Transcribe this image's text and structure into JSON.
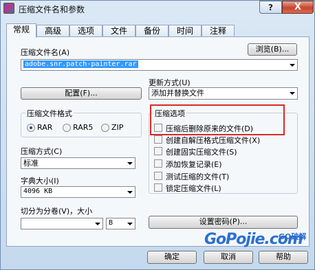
{
  "title": "压缩文件名和参数",
  "window": {
    "help": "?",
    "close": "X"
  },
  "tabs": [
    "常规",
    "高级",
    "选项",
    "文件",
    "备份",
    "时间",
    "注释"
  ],
  "archive_name": {
    "label": "压缩文件名(A)",
    "browse": "浏览(B)...",
    "value": "adobe.snr.patch-painter.rar"
  },
  "update_mode": {
    "label": "更新方式(U)",
    "value": "添加并替换文件"
  },
  "config_button": "配置(F)...",
  "format": {
    "title": "压缩文件格式",
    "options": [
      "RAR",
      "RAR5",
      "ZIP"
    ],
    "selected": "RAR"
  },
  "method": {
    "label": "压缩方式(C)",
    "value": "标准"
  },
  "dictionary": {
    "label": "字典大小(I)",
    "value": "4096 KB"
  },
  "split": {
    "label": "切分为分卷(V)，大小",
    "value": "",
    "unit": "B"
  },
  "options": {
    "title": "压缩选项",
    "items": [
      {
        "label": "压缩后删除原来的文件(D)",
        "checked": false
      },
      {
        "label": "创建自解压格式压缩文件(X)",
        "checked": false
      },
      {
        "label": "创建固实压缩文件(S)",
        "checked": false
      },
      {
        "label": "添加恢复记录(E)",
        "checked": false
      },
      {
        "label": "测试压缩的文件(T)",
        "checked": false
      },
      {
        "label": "锁定压缩文件(L)",
        "checked": false
      }
    ]
  },
  "password_button": "设置密码(P)...",
  "footer": {
    "ok": "确定",
    "cancel": "取消",
    "help": "帮助"
  },
  "watermark": {
    "main": "GoPojie.com",
    "sub": "GO破解"
  },
  "colors": {
    "highlight": "#d62a2a",
    "watermark": "#2c6fd1",
    "selection": "#3399ff"
  }
}
